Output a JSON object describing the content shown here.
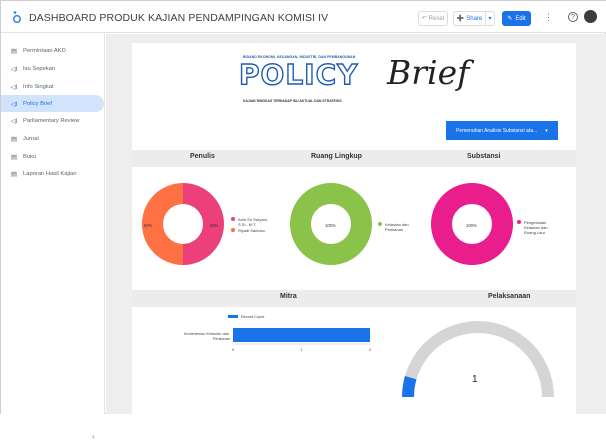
{
  "header": {
    "title": "DASHBOARD PRODUK KAJIAN PENDAMPINGAN KOMISI IV",
    "reset_label": "Reset",
    "share_label": "Share",
    "edit_label": "Edit",
    "avatar_initials": ""
  },
  "sidebar": {
    "items": [
      {
        "label": "Permintaan AKD",
        "icon": "document-icon",
        "active": false
      },
      {
        "label": "Isu Sepekan",
        "icon": "megaphone-icon",
        "active": false
      },
      {
        "label": "Info Singkat",
        "icon": "megaphone-icon",
        "active": false
      },
      {
        "label": "Policy Brief",
        "icon": "megaphone-icon",
        "active": true
      },
      {
        "label": "Parliamentary Review",
        "icon": "megaphone-icon",
        "active": false
      },
      {
        "label": "Jurnal",
        "icon": "document-icon",
        "active": false
      },
      {
        "label": "Buku",
        "icon": "document-icon",
        "active": false
      },
      {
        "label": "Laporan Hasil Kajian",
        "icon": "document-icon",
        "active": false
      }
    ]
  },
  "banner": {
    "top_line": "BIDANG EKONOMI, KEUANGAN, INDUSTRI, DAN PEMBANGUNAN",
    "policy": "POLICY",
    "brief": "Brief",
    "sub_line": "KAJIAN RINGKAS TERHADAP ISU AKTUAL DAN STRATEGIS"
  },
  "filter": {
    "selected": "Pemenuhan Analisis Substansi ata..."
  },
  "sections": {
    "penulis": "Penulis",
    "ruang_lingkup": "Ruang Lingkup",
    "substansi": "Substansi",
    "mitra": "Mitra",
    "pelaksanaan": "Pelaksanaan"
  },
  "colors": {
    "pink_dark": "#ec407a",
    "orange": "#ff7043",
    "green": "#8bc34a",
    "magenta": "#e91e8c",
    "blue": "#1a73e8",
    "gauge_gray": "#d5d5d5"
  },
  "chart_data": [
    {
      "type": "pie",
      "title": "Penulis",
      "categories": [
        "Anih Sri Suryani, S.Si., M.T.",
        "Riyadi Santoso"
      ],
      "values": [
        50,
        50
      ],
      "labels": [
        "50%",
        "50%"
      ]
    },
    {
      "type": "pie",
      "title": "Ruang Lingkup",
      "categories": [
        "Kelautan dan Perikanan"
      ],
      "values": [
        100
      ],
      "labels": [
        "100%"
      ]
    },
    {
      "type": "pie",
      "title": "Substansi",
      "categories": [
        "Pengelolaan Kelautan dan Ruang Laut"
      ],
      "values": [
        100
      ],
      "labels": [
        "100%"
      ]
    },
    {
      "type": "bar",
      "title": "Mitra",
      "orientation": "horizontal",
      "series": [
        {
          "name": "Record Count",
          "values": [
            2
          ]
        }
      ],
      "categories": [
        "Kementerian Kelautan dan Perikanan"
      ],
      "xlim": [
        0,
        2
      ],
      "xticks": [
        "0",
        "1",
        "2"
      ]
    },
    {
      "type": "gauge",
      "title": "Pelaksanaan",
      "value": 1,
      "value_label": "1"
    }
  ]
}
